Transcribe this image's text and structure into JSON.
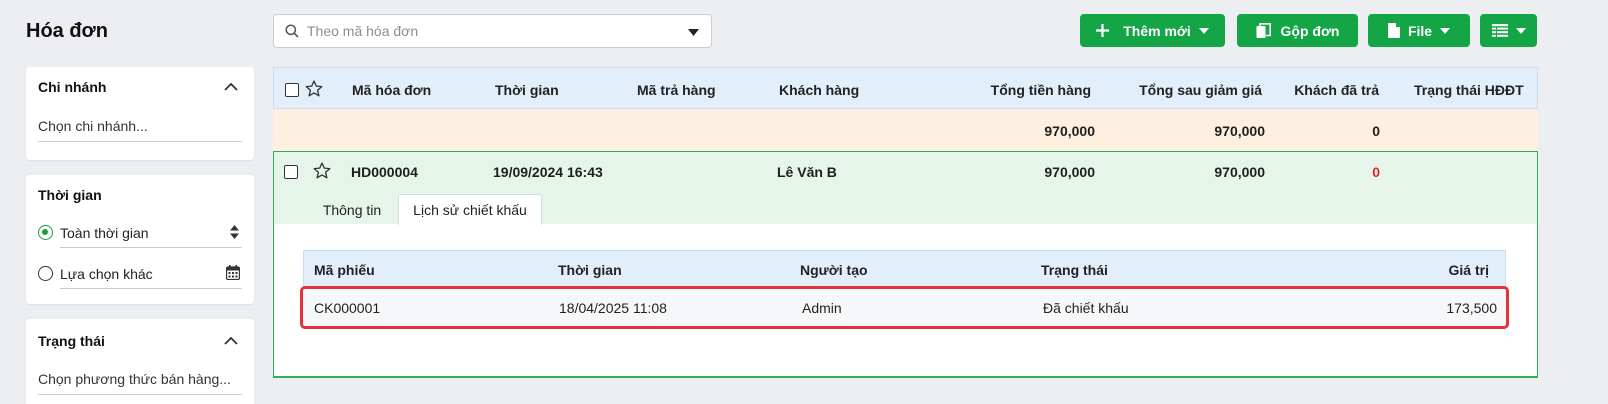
{
  "page": {
    "title": "Hóa đơn"
  },
  "filters": {
    "branch": {
      "title": "Chi nhánh",
      "placeholder": "Chọn chi nhánh..."
    },
    "time": {
      "title": "Thời gian",
      "option_all": "Toàn thời gian",
      "option_custom": "Lựa chọn khác"
    },
    "status": {
      "title": "Trạng thái",
      "placeholder": "Chọn phương thức bán hàng..."
    }
  },
  "search": {
    "placeholder": "Theo mã hóa đơn"
  },
  "toolbar": {
    "add_label": "Thêm mới",
    "merge_label": "Gộp đơn",
    "file_label": "File"
  },
  "table": {
    "columns": {
      "code": "Mã hóa đơn",
      "time": "Thời gian",
      "return_code": "Mã trả hàng",
      "customer": "Khách hàng",
      "total": "Tổng tiền hàng",
      "after_discount": "Tổng sau giảm giá",
      "paid": "Khách đã trả",
      "einvoice_status": "Trạng thái HĐĐT"
    },
    "summary": {
      "total": "970,000",
      "after_discount": "970,000",
      "paid": "0"
    },
    "row": {
      "code": "HD000004",
      "time": "19/09/2024 16:43",
      "customer": "Lê Văn B",
      "total": "970,000",
      "after_discount": "970,000",
      "paid": "0"
    },
    "tabs": {
      "info": "Thông tin",
      "discount_history": "Lịch sử chiết khấu"
    }
  },
  "history": {
    "columns": {
      "code": "Mã phiếu",
      "time": "Thời gian",
      "creator": "Người tạo",
      "status": "Trạng thái",
      "value": "Giá trị"
    },
    "rows": [
      {
        "code": "CK000001",
        "time": "18/04/2025 11:08",
        "creator": "Admin",
        "status": "Đã chiết khấu",
        "value": "173,500"
      }
    ]
  },
  "colors": {
    "accent": "#13a546",
    "link": "#1a6fd1",
    "danger": "#e3242b",
    "highlight": "#e0343a"
  }
}
